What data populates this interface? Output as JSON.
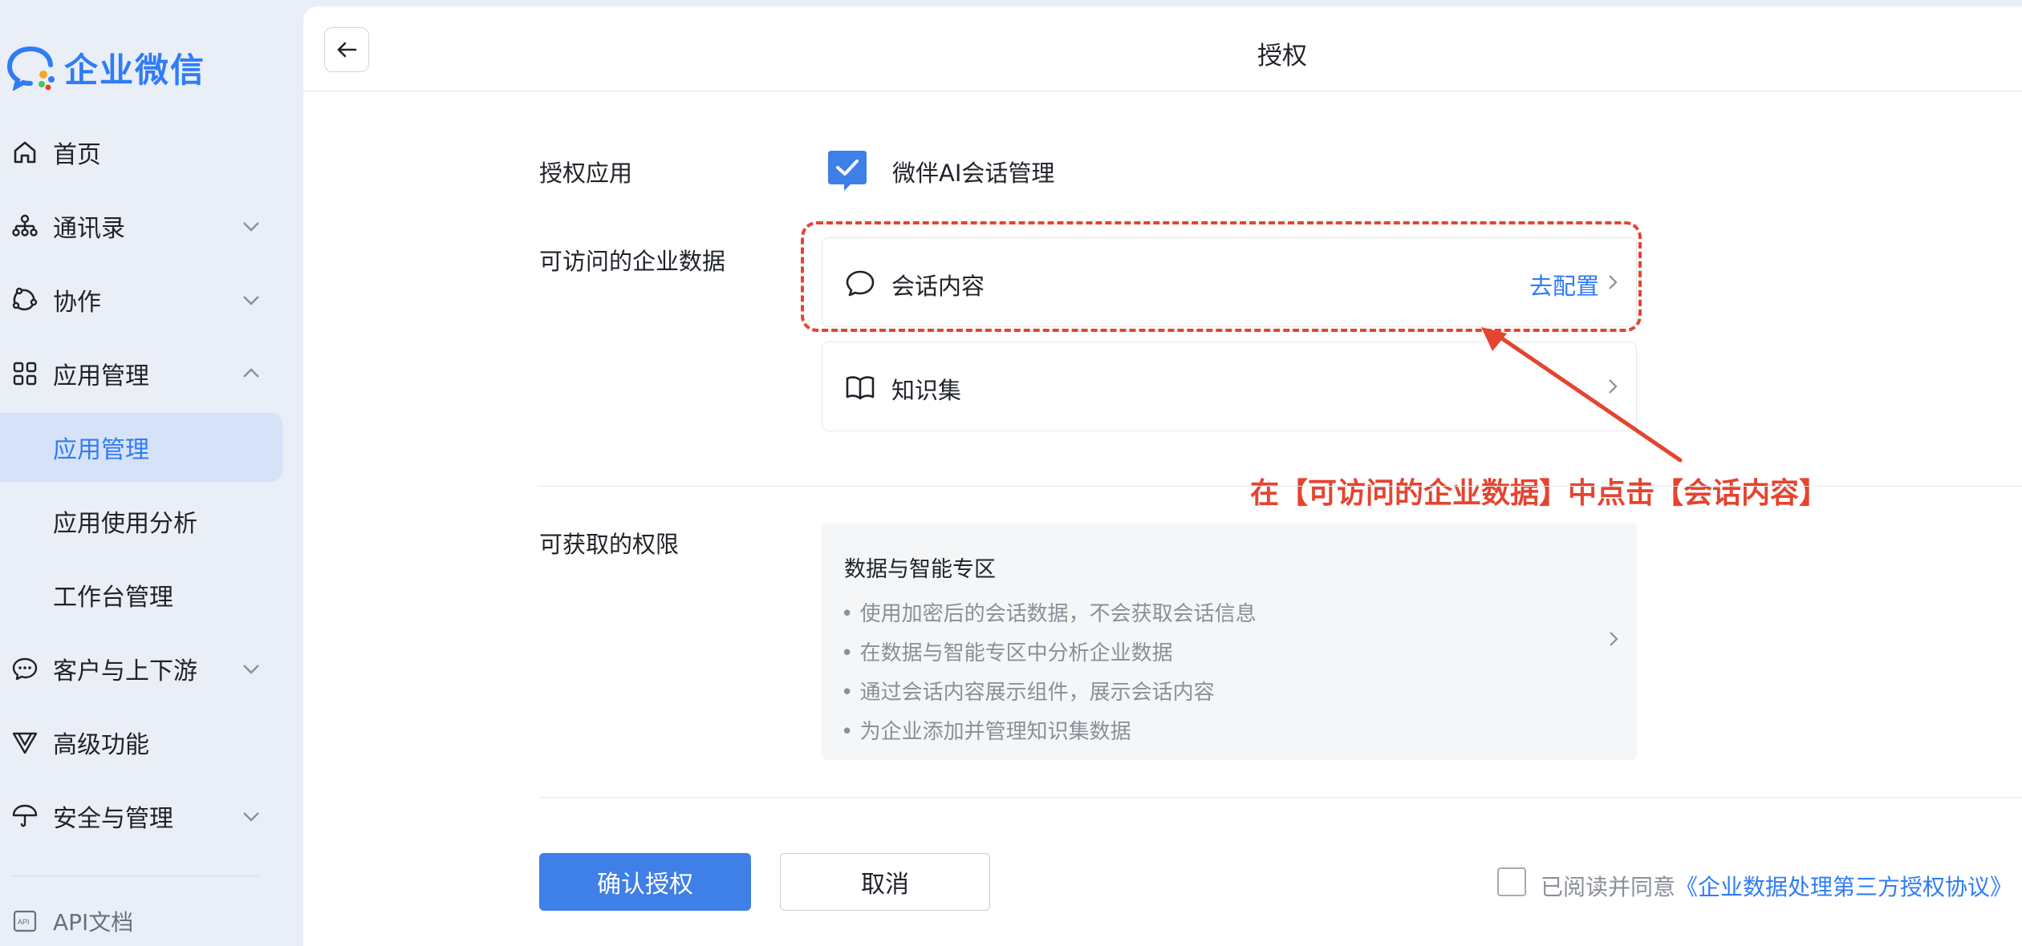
{
  "brand": {
    "name": "企业微信"
  },
  "sidebar": {
    "items": [
      {
        "label": "首页",
        "icon": "home-icon"
      },
      {
        "label": "通讯录",
        "icon": "org-chart-icon"
      },
      {
        "label": "协作",
        "icon": "collaboration-icon"
      },
      {
        "label": "应用管理",
        "icon": "grid-apps-icon"
      },
      {
        "label": "应用管理"
      },
      {
        "label": "应用使用分析"
      },
      {
        "label": "工作台管理"
      },
      {
        "label": "客户与上下游",
        "icon": "chat-bubble-icon"
      },
      {
        "label": "高级功能",
        "icon": "advanced-icon"
      },
      {
        "label": "安全与管理",
        "icon": "umbrella-icon"
      }
    ],
    "api_doc": "API文档"
  },
  "header": {
    "title": "授权"
  },
  "form": {
    "auth_app_label": "授权应用",
    "app_name": "微伴AI会话管理",
    "data_label": "可访问的企业数据",
    "data_items": [
      {
        "label": "会话内容",
        "action": "去配置",
        "icon": "chat-bubble-icon"
      },
      {
        "label": "知识集",
        "icon": "book-icon"
      }
    ],
    "annotation": "在【可访问的企业数据】中点击【会话内容】",
    "perm_label": "可获取的权限",
    "perm": {
      "title": "数据与智能专区",
      "lines": [
        "• 使用加密后的会话数据，不会获取会话信息",
        "• 在数据与智能专区中分析企业数据",
        "• 通过会话内容展示组件，展示会话内容",
        "• 为企业添加并管理知识集数据"
      ]
    }
  },
  "footer": {
    "confirm": "确认授权",
    "cancel": "取消",
    "agree_prefix": "已阅读并同意",
    "agree_link": "《企业数据处理第三方授权协议》"
  },
  "colors": {
    "accent": "#2f7cf6",
    "annotation": "#e5442f",
    "sidebar_bg": "#e9eef7"
  }
}
